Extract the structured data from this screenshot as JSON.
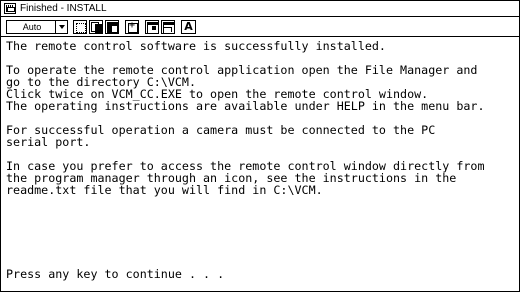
{
  "window": {
    "title": "Finished - INSTALL",
    "system_menu_icon": "msdos-window-icon"
  },
  "toolbar": {
    "font_size": "Auto",
    "buttons": [
      {
        "name": "mark-icon"
      },
      {
        "name": "copy-icon"
      },
      {
        "name": "paste-icon"
      },
      {
        "name": "full-screen-icon"
      },
      {
        "name": "properties-icon"
      },
      {
        "name": "background-icon"
      },
      {
        "name": "font-icon",
        "glyph": "A"
      }
    ]
  },
  "console": {
    "lines": [
      "The remote control software is successfully installed.",
      "To operate the remote control application open the File Manager and",
      "go to the directory C:\\VCM.",
      "Click twice on VCM_CC.EXE to open the remote control window.",
      "The operating instructions are available under HELP in the menu bar.",
      "For successful operation a camera must be connected to the PC",
      "serial port.",
      "In case you prefer to access the remote control window directly from",
      "the program manager through an icon, see the instructions in the",
      "readme.txt file that you will find in C:\\VCM.",
      "Press any key to continue . . ."
    ]
  }
}
